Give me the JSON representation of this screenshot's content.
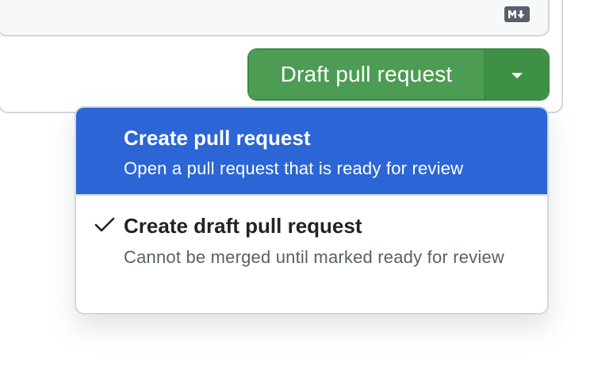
{
  "toolbar": {
    "markdown_icon": "markdown-icon"
  },
  "split_button": {
    "label": "Draft pull request",
    "caret_icon": "triangle-down-icon",
    "accent_color": "#4c9c53"
  },
  "dropdown": {
    "items": [
      {
        "title": "Create pull request",
        "description": "Open a pull request that is ready for review",
        "selected": false,
        "highlighted": true
      },
      {
        "title": "Create draft pull request",
        "description": "Cannot be merged until marked ready for review",
        "selected": true,
        "highlighted": false,
        "icon": "check-icon"
      }
    ],
    "highlight_color": "#2c66d6"
  }
}
